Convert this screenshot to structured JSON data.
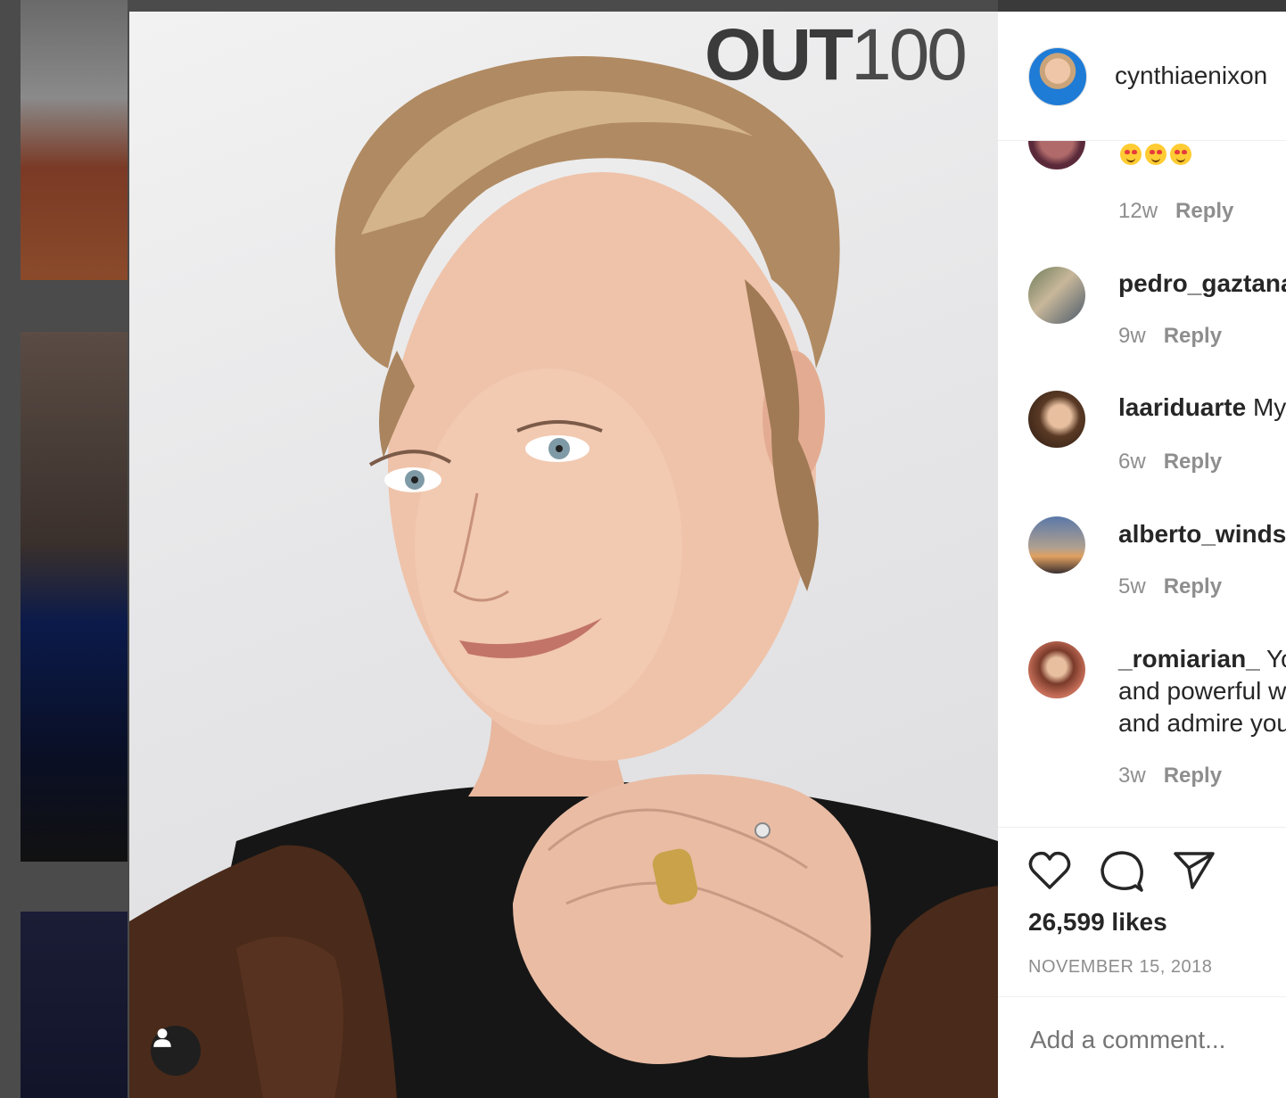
{
  "post": {
    "logo_bold": "OUT",
    "logo_light": "100",
    "author": "cynthiaenixon"
  },
  "comments": [
    {
      "username": "",
      "text": "",
      "emojis": 3,
      "age": "12w",
      "reply": "Reply"
    },
    {
      "username": "pedro_gaztana",
      "text": "",
      "age": "9w",
      "reply": "Reply"
    },
    {
      "username": "laariduarte",
      "text": "My",
      "age": "6w",
      "reply": "Reply"
    },
    {
      "username": "alberto_windsu",
      "text": "",
      "age": "5w",
      "reply": "Reply"
    },
    {
      "username": "_romiarian_",
      "text": "Yo",
      "line2": "and powerful w",
      "line3": "and admire you",
      "age": "3w",
      "reply": "Reply"
    }
  ],
  "actions": {
    "like_icon": "heart-icon",
    "comment_icon": "comment-icon",
    "share_icon": "share-icon"
  },
  "likes": "26,599 likes",
  "date": "NOVEMBER 15, 2018",
  "comment_box": {
    "placeholder": "Add a comment..."
  }
}
